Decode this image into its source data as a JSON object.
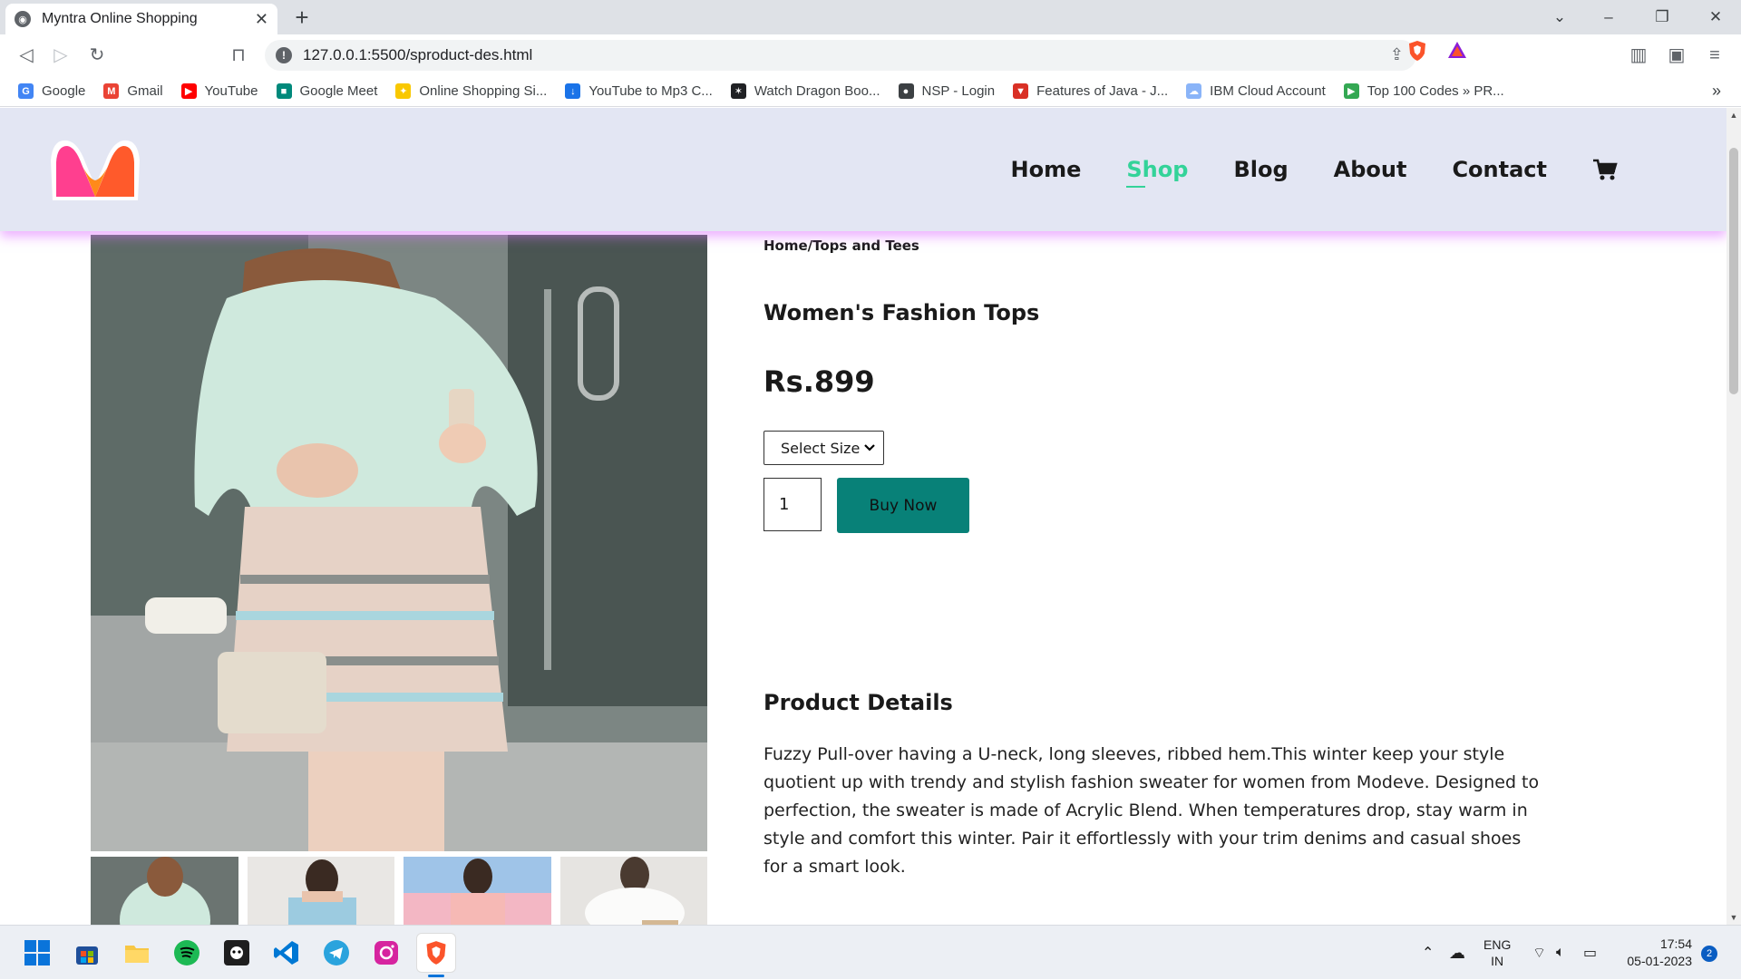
{
  "browser": {
    "tab_title": "Myntra Online Shopping",
    "url": "127.0.0.1:5500/sproduct-des.html",
    "bookmarks": [
      {
        "label": "Google",
        "color": "#4285f4",
        "glyph": "G"
      },
      {
        "label": "Gmail",
        "color": "#ea4335",
        "glyph": "M"
      },
      {
        "label": "YouTube",
        "color": "#ff0000",
        "glyph": "▶"
      },
      {
        "label": "Google Meet",
        "color": "#00897b",
        "glyph": "■"
      },
      {
        "label": "Online Shopping Si...",
        "color": "#f9c800",
        "glyph": "✦"
      },
      {
        "label": "YouTube to Mp3 C...",
        "color": "#1a73e8",
        "glyph": "↓"
      },
      {
        "label": "Watch Dragon Boo...",
        "color": "#202124",
        "glyph": "✶"
      },
      {
        "label": "NSP - Login",
        "color": "#3c4043",
        "glyph": "●"
      },
      {
        "label": "Features of Java - J...",
        "color": "#d93025",
        "glyph": "▼"
      },
      {
        "label": "IBM Cloud Account",
        "color": "#8ab4f8",
        "glyph": "☁"
      },
      {
        "label": "Top 100 Codes » PR...",
        "color": "#34a853",
        "glyph": "▶"
      }
    ]
  },
  "site": {
    "nav": [
      {
        "label": "Home",
        "active": false
      },
      {
        "label": "Shop",
        "active": true
      },
      {
        "label": "Blog",
        "active": false
      },
      {
        "label": "About",
        "active": false
      },
      {
        "label": "Contact",
        "active": false
      }
    ],
    "accent_color": "#088178",
    "active_nav_color": "#34d399"
  },
  "product": {
    "breadcrumb": "Home/Tops and Tees",
    "title": "Women's Fashion Tops",
    "price": "Rs.899",
    "size_select": "Select Size",
    "quantity": "1",
    "buy_label": "Buy Now",
    "details_heading": "Product Details",
    "description": "Fuzzy Pull-over having a U-neck, long sleeves, ribbed hem.This winter keep your style quotient up with trendy and stylish fashion sweater for women from Modeve. Designed to perfection, the sweater is made of Acrylic Blend. When temperatures drop, stay warm in style and comfort this winter. Pair it effortlessly with your trim denims and casual shoes for a smart look."
  },
  "taskbar": {
    "lang_top": "ENG",
    "lang_bottom": "IN",
    "time": "17:54",
    "date": "05-01-2023",
    "notif_count": "2"
  }
}
